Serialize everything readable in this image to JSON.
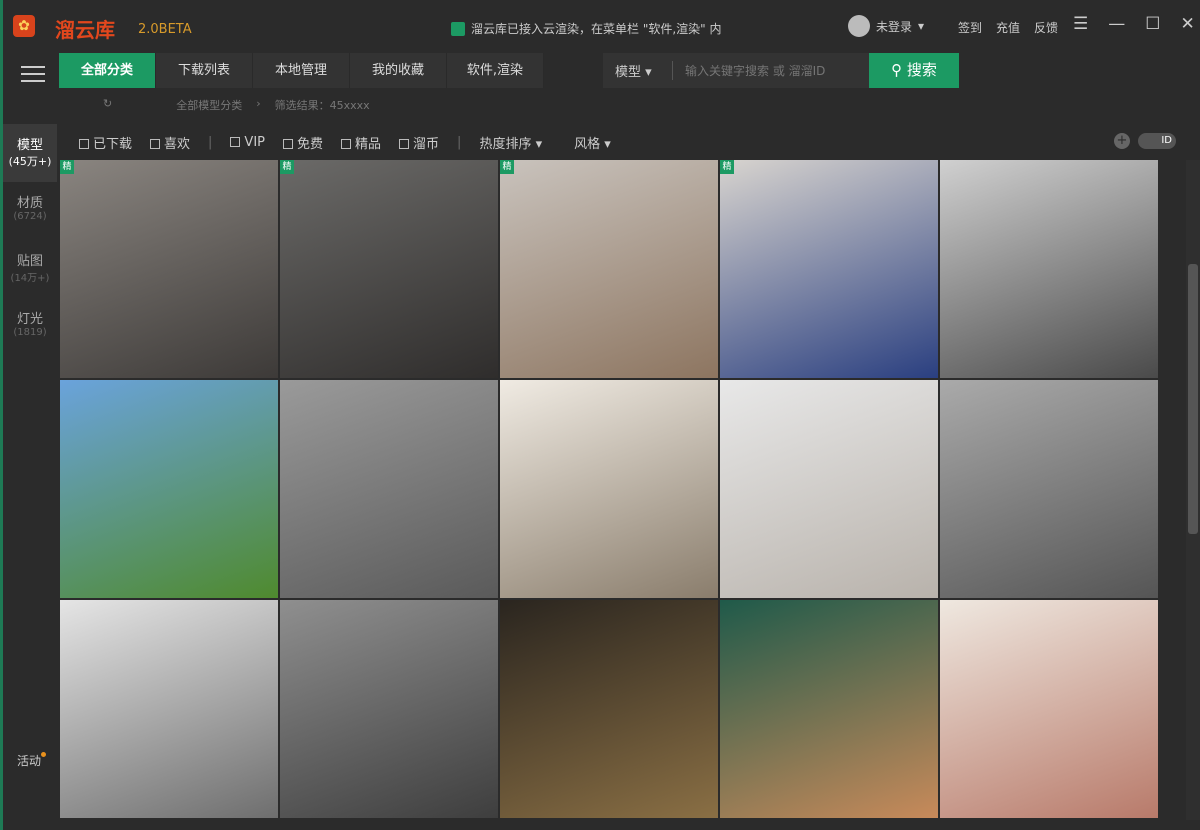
{
  "app": {
    "name": "溜云库",
    "version": "2.0BETA",
    "notice": "溜云库已接入云渲染，在菜单栏 \"软件,渲染\" 内"
  },
  "user": {
    "name": "未登录"
  },
  "top_links": [
    "签到",
    "充值",
    "反馈"
  ],
  "window_controls": [
    "☰",
    "—",
    "☐",
    "✕"
  ],
  "tabs": [
    {
      "label": "全部分类",
      "active": true
    },
    {
      "label": "下载列表"
    },
    {
      "label": "本地管理"
    },
    {
      "label": "我的收藏"
    },
    {
      "label": "软件,渲染"
    }
  ],
  "search": {
    "type": "模型",
    "placeholder": "输入关键字搜索 或 溜溜ID",
    "button": "搜索"
  },
  "breadcrumb": {
    "root": "全部模型分类",
    "result": "筛选结果：45xxxx"
  },
  "sidebar": [
    {
      "label": "模型",
      "count": "(45万+)",
      "active": true
    },
    {
      "label": "材质",
      "count": "(6724)"
    },
    {
      "label": "贴图",
      "count": "(14万+)"
    },
    {
      "label": "灯光",
      "count": "(1819)"
    }
  ],
  "activity": "活动",
  "filters": {
    "checks1": [
      "已下载",
      "喜欢"
    ],
    "checks2": [
      "VIP",
      "免费",
      "精品",
      "溜币"
    ],
    "sort": "热度排序",
    "style": "风格",
    "toggle": "ID"
  },
  "badge": "精",
  "tiles": [
    {
      "c": "#8a8580,#3d3a38",
      "b": true
    },
    {
      "c": "#6b6a68,#2f2d2c",
      "b": true
    },
    {
      "c": "#c9c3bd,#8d7560",
      "b": true
    },
    {
      "c": "#d8d4cf,#2a3f80",
      "b": true
    },
    {
      "c": "#d0d0d0,#4a4a4a"
    },
    {
      "c": "#6aa3dc,#4f8a2e"
    },
    {
      "c": "#9a9a9a,#5a5a5a"
    },
    {
      "c": "#f0ebe3,#8a7d6c"
    },
    {
      "c": "#e8e8e8,#b8b2ab"
    },
    {
      "c": "#aaaaaa,#555"
    },
    {
      "c": "#e5e5e5,#6e6e6e"
    },
    {
      "c": "#8f8f8f,#3e3e3e"
    },
    {
      "c": "#2a251f,#8a6f44"
    },
    {
      "c": "#1f5a4a,#c88a5a"
    },
    {
      "c": "#efe8e0,#b87a6a"
    }
  ]
}
